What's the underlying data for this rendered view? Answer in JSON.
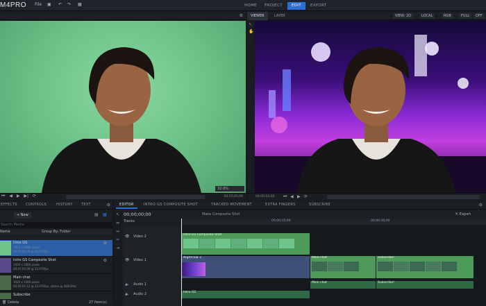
{
  "app": {
    "logo_text": "M4PRO",
    "logo_prefix": "HITFILM"
  },
  "menu": {
    "file": "File"
  },
  "workspace_tabs": [
    {
      "label": "HOME"
    },
    {
      "label": "PROJECT"
    },
    {
      "label": "EDIT"
    },
    {
      "label": "EXPORT"
    }
  ],
  "viewer": {
    "tabs": [
      {
        "label": "VIEWER"
      },
      {
        "label": "LAYER"
      }
    ],
    "view_dropdown": "VIEW: 2D",
    "space_dropdown": "LOCAL",
    "color_dropdown": "RGB",
    "quality_dropdown": "FULL",
    "zoom_dropdown": "OFF",
    "timecode": "00;00;00;00"
  },
  "source": {
    "zoom": "32.0%",
    "timecode": "00;03;05;09"
  },
  "left_panel": {
    "tabs": [
      {
        "label": "EFFECTS"
      },
      {
        "label": "CONTROLS"
      },
      {
        "label": "HISTORY"
      },
      {
        "label": "TEXT"
      }
    ],
    "new_button": "New",
    "search_placeholder": "Search Media",
    "name_header": "Name",
    "group_by": "Group By: Folder",
    "items": [
      {
        "title": "Intro GS",
        "line1": "1920 x 1080 pixels",
        "line2": "00;07;05;09 @ 23.976fps"
      },
      {
        "title": "Intro GS Composite Shot",
        "line1": "1920 x 1080 pixels",
        "line2": "00;07;05;09 @ 23.976fps"
      },
      {
        "title": "Main chat",
        "line1": "1920 x 1080 pixels",
        "line2": "00;02;05;13 @ 23.976fps, stereo @ 48000Hz"
      },
      {
        "title": "Subscribe",
        "line1": "1920 x 1080 pixels",
        "line2": "00;00;05;09 @ 23.976fps, stereo @ 48000Hz"
      }
    ],
    "delete_label": "Delete",
    "count_label": "27 Item(s)"
  },
  "editor": {
    "tabs": [
      {
        "label": "EDITOR"
      },
      {
        "label": "INTRO GS COMPOSITE SHOT"
      },
      {
        "label": "TRACKED MOVEMENT"
      },
      {
        "label": "EXTRA FINGERS"
      },
      {
        "label": "SUBSCRIBE"
      }
    ],
    "timecode": "00;00;00;00",
    "make_composite": "Make Composite Shot",
    "export_label": "Export",
    "tracks_label": "Tracks",
    "ruler": [
      {
        "label": "00;00;15;00"
      },
      {
        "label": "00;00;30;00"
      }
    ],
    "tracks": [
      {
        "label": "Video 2"
      },
      {
        "label": "Video 1"
      },
      {
        "label": "Audio 1"
      },
      {
        "label": "Audio 2"
      }
    ],
    "clips": {
      "v2": "Intro GS Composite Shot",
      "v1a": "Nightclub 3",
      "v1b": "Main chat",
      "v1c": "Subscribe!",
      "a1a": "Main chat",
      "a1b": "Subscribe!",
      "a2": "Intro GS"
    }
  },
  "colors": {
    "accent": "#2a6fd6",
    "green_clip": "#4e9a5a",
    "audio_clip": "#2f6a45"
  }
}
